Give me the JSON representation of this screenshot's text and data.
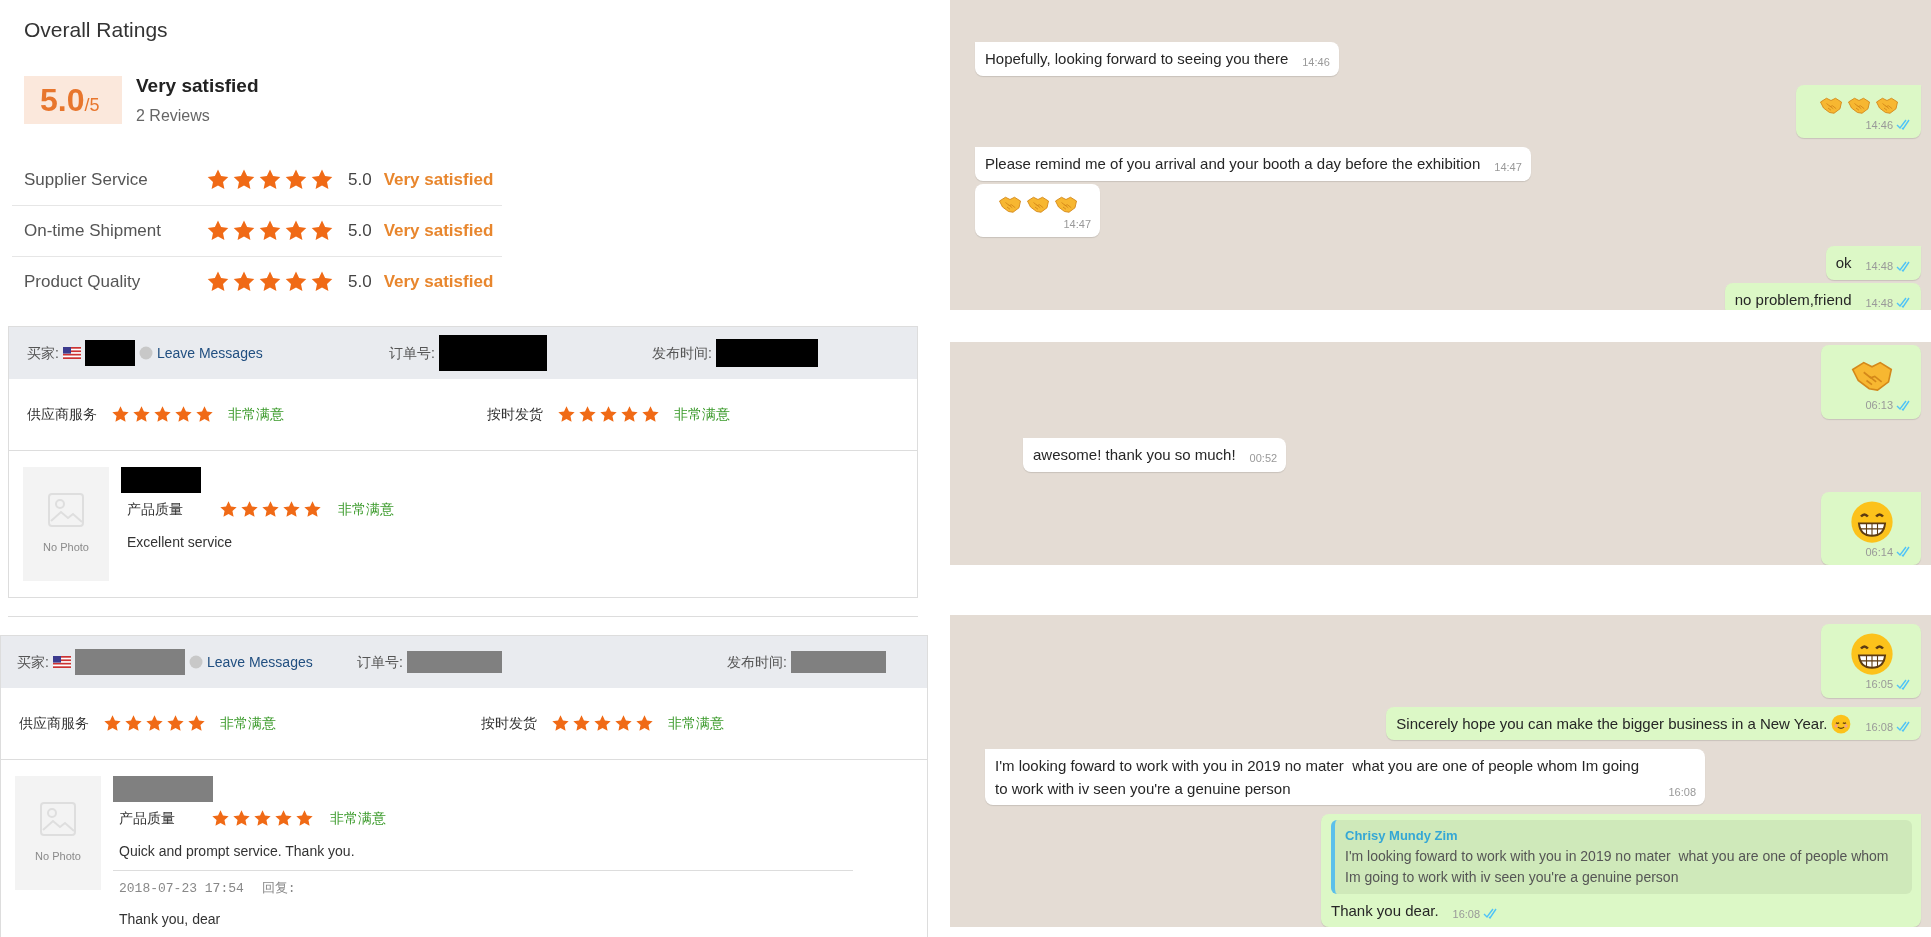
{
  "overall": {
    "title": "Overall Ratings",
    "score": "5.0",
    "out_of": "/5",
    "verdict": "Very satisfied",
    "reviews": "2 Reviews",
    "rows": [
      {
        "label": "Supplier Service",
        "stars": 5,
        "score": "5.0",
        "verdict": "Very satisfied"
      },
      {
        "label": "On-time Shipment",
        "stars": 5,
        "score": "5.0",
        "verdict": "Very satisfied"
      },
      {
        "label": "Product Quality",
        "stars": 5,
        "score": "5.0",
        "verdict": "Very satisfied"
      }
    ]
  },
  "reviews": [
    {
      "buyer_label": "买家:",
      "link": "Leave Messages",
      "order_label": "订单号:",
      "date_label": "发布时间:",
      "color": "#000000",
      "ratings": [
        {
          "label": "供应商服务",
          "stars": 5,
          "verdict": "非常满意"
        },
        {
          "label": "按时发货",
          "stars": 5,
          "verdict": "非常满意"
        }
      ],
      "product": {
        "photo": "No Photo",
        "label": "产品质量",
        "stars": 5,
        "verdict": "非常满意"
      },
      "comment": "Excellent service"
    },
    {
      "buyer_label": "买家:",
      "link": "Leave Messages",
      "order_label": "订单号:",
      "date_label": "发布时间:",
      "color": "#808080",
      "ratings": [
        {
          "label": "供应商服务",
          "stars": 5,
          "verdict": "非常满意"
        },
        {
          "label": "按时发货",
          "stars": 5,
          "verdict": "非常满意"
        }
      ],
      "product": {
        "photo": "No Photo",
        "label": "产品质量",
        "stars": 5,
        "verdict": "非常满意"
      },
      "comment": "Quick and prompt service. Thank you.",
      "reply": {
        "time": "2018-07-23 17:54",
        "label": "回复:",
        "text": "Thank you, dear"
      }
    }
  ],
  "chats": [
    {
      "messages": [
        {
          "kind": "text",
          "outgoing": false,
          "tail": true,
          "text": "Hopefully, looking forward to seeing you there",
          "time": "14:46"
        },
        {
          "kind": "emoji",
          "outgoing": true,
          "tail": true,
          "emojis": [
            {
              "kind": "handshake"
            },
            {
              "kind": "handshake"
            },
            {
              "kind": "handshake"
            }
          ],
          "time": "14:46",
          "read": true
        },
        {
          "kind": "text",
          "outgoing": false,
          "tail": true,
          "text": "Please remind me of you arrival and your booth a day before the exhibition",
          "time": "14:47"
        },
        {
          "kind": "emoji",
          "outgoing": false,
          "tail": false,
          "emojis": [
            {
              "kind": "handshake"
            },
            {
              "kind": "handshake"
            },
            {
              "kind": "handshake"
            }
          ],
          "time": "14:47"
        },
        {
          "kind": "text",
          "outgoing": true,
          "tail": true,
          "text": "ok",
          "time": "14:48",
          "read": true
        },
        {
          "kind": "text",
          "outgoing": true,
          "tail": false,
          "text": "no problem,friend",
          "time": "14:48",
          "read": true
        }
      ]
    },
    {
      "messages": [
        {
          "kind": "emoji",
          "outgoing": true,
          "tail": false,
          "emojis": [
            {
              "kind": "handshake"
            }
          ],
          "time": "06:13",
          "read": true
        },
        {
          "kind": "text",
          "outgoing": false,
          "tail": true,
          "text": "awesome! thank you so much!",
          "time": "00:52"
        },
        {
          "kind": "emoji",
          "outgoing": true,
          "tail": true,
          "emojis": [
            {
              "kind": "grin"
            }
          ],
          "time": "06:14",
          "read": true
        }
      ]
    },
    {
      "messages": [
        {
          "kind": "emoji",
          "outgoing": true,
          "tail": false,
          "emojis": [
            {
              "kind": "grin"
            }
          ],
          "time": "16:05",
          "read": true
        },
        {
          "kind": "text",
          "outgoing": true,
          "tail": true,
          "text": "Sincerely hope you can make the bigger business in a New Year.",
          "emojis": [
            {
              "kind": "relieved"
            }
          ],
          "time": "16:08",
          "read": true
        },
        {
          "kind": "text",
          "outgoing": false,
          "tail": true,
          "text": "I'm looking foward to work with you in 2019 no mater  what you are one of people whom Im going to work with iv seen you're a genuine person",
          "time": "16:08"
        },
        {
          "kind": "text",
          "outgoing": true,
          "tail": true,
          "quote": {
            "author": "Chrisy Mundy Zim",
            "text": "I'm looking foward to work with you in 2019 no mater  what you are one of people whom Im going to work with iv seen you're a genuine person"
          },
          "text": "Thank you dear.",
          "time": "16:08",
          "read": true
        }
      ]
    }
  ]
}
